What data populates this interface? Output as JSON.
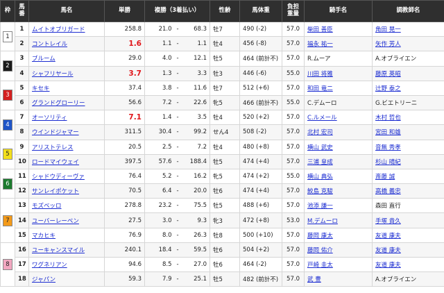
{
  "headers": {
    "waku": "枠",
    "umaban": "馬番",
    "horse": "馬名",
    "odds": "単勝",
    "place": "複勝（3着払い）",
    "sexage": "性齢",
    "weight": "馬体重",
    "load": "負担\n重量",
    "jockey": "騎手名",
    "trainer": "調教師名"
  },
  "frames": [
    {
      "label": "1",
      "color": "#ffffff",
      "text": "#222222",
      "rows": 2
    },
    {
      "label": "2",
      "color": "#1b1b1b",
      "text": "#ffffff",
      "rows": 2
    },
    {
      "label": "3",
      "color": "#d42020",
      "text": "#ffffff",
      "rows": 2
    },
    {
      "label": "4",
      "color": "#1f55c8",
      "text": "#ffffff",
      "rows": 2
    },
    {
      "label": "5",
      "color": "#f3df1c",
      "text": "#222222",
      "rows": 2
    },
    {
      "label": "6",
      "color": "#1c7a2e",
      "text": "#ffffff",
      "rows": 2
    },
    {
      "label": "7",
      "color": "#f39a1a",
      "text": "#222222",
      "rows": 3
    },
    {
      "label": "8",
      "color": "#f2a7c0",
      "text": "#222222",
      "rows": 3
    }
  ],
  "horses": [
    {
      "num": "1",
      "name": "ムイトオブリガード",
      "odds": "258.8",
      "hot": false,
      "pl_lo": "21.0",
      "pl_hi": "68.3",
      "sexage": "牡7",
      "weight": "490 (-2)",
      "load": "57.0",
      "jockey": "柴田 善臣",
      "jockey_link": true,
      "trainer": "角田 晃一",
      "trainer_link": true
    },
    {
      "num": "2",
      "name": "コントレイル",
      "odds": "1.6",
      "hot": true,
      "pl_lo": "1.1",
      "pl_hi": "1.1",
      "sexage": "牡4",
      "weight": "456 (-8)",
      "load": "57.0",
      "jockey": "福永 祐一",
      "jockey_link": true,
      "trainer": "矢作 芳人",
      "trainer_link": true
    },
    {
      "num": "3",
      "name": "ブルーム",
      "odds": "29.0",
      "hot": false,
      "pl_lo": "4.0",
      "pl_hi": "12.1",
      "sexage": "牡5",
      "weight": "464 (前計不)",
      "load": "57.0",
      "jockey": "R.ムーア",
      "jockey_link": false,
      "trainer": "A.オブライエン",
      "trainer_link": false
    },
    {
      "num": "4",
      "name": "シャフリヤール",
      "odds": "3.7",
      "hot": true,
      "pl_lo": "1.3",
      "pl_hi": "3.3",
      "sexage": "牡3",
      "weight": "446 (-6)",
      "load": "55.0",
      "jockey": "川田 将雅",
      "jockey_link": true,
      "trainer": "藤原 英昭",
      "trainer_link": true
    },
    {
      "num": "5",
      "name": "キセキ",
      "odds": "37.4",
      "hot": false,
      "pl_lo": "3.8",
      "pl_hi": "11.6",
      "sexage": "牡7",
      "weight": "512 (+6)",
      "load": "57.0",
      "jockey": "和田 竜二",
      "jockey_link": true,
      "trainer": "辻野 泰之",
      "trainer_link": true
    },
    {
      "num": "6",
      "name": "グランドグローリー",
      "odds": "56.6",
      "hot": false,
      "pl_lo": "7.2",
      "pl_hi": "22.6",
      "sexage": "牝5",
      "weight": "466 (前計不)",
      "load": "55.0",
      "jockey": "C.デムーロ",
      "jockey_link": false,
      "trainer": "G.ビエトリーニ",
      "trainer_link": false
    },
    {
      "num": "7",
      "name": "オーソリティ",
      "odds": "7.1",
      "hot": true,
      "pl_lo": "1.4",
      "pl_hi": "3.5",
      "sexage": "牡4",
      "weight": "520 (+2)",
      "load": "57.0",
      "jockey": "C.ルメール",
      "jockey_link": true,
      "trainer": "木村 哲也",
      "trainer_link": true
    },
    {
      "num": "8",
      "name": "ウインドジャマー",
      "odds": "311.5",
      "hot": false,
      "pl_lo": "30.4",
      "pl_hi": "99.2",
      "sexage": "せん4",
      "weight": "508 (-2)",
      "load": "57.0",
      "jockey": "北村 宏司",
      "jockey_link": true,
      "trainer": "宮田 和雄",
      "trainer_link": true
    },
    {
      "num": "9",
      "name": "アリストテレス",
      "odds": "20.5",
      "hot": false,
      "pl_lo": "2.5",
      "pl_hi": "7.2",
      "sexage": "牡4",
      "weight": "480 (+8)",
      "load": "57.0",
      "jockey": "横山 武史",
      "jockey_link": true,
      "trainer": "音無 秀孝",
      "trainer_link": true
    },
    {
      "num": "10",
      "name": "ロードマイウェイ",
      "odds": "397.5",
      "hot": false,
      "pl_lo": "57.6",
      "pl_hi": "188.4",
      "sexage": "牡5",
      "weight": "474 (+4)",
      "load": "57.0",
      "jockey": "三浦 皇成",
      "jockey_link": true,
      "trainer": "杉山 晴紀",
      "trainer_link": true
    },
    {
      "num": "11",
      "name": "シャドウディーヴァ",
      "odds": "76.4",
      "hot": false,
      "pl_lo": "5.2",
      "pl_hi": "16.2",
      "sexage": "牝5",
      "weight": "474 (+2)",
      "load": "55.0",
      "jockey": "横山 典弘",
      "jockey_link": true,
      "trainer": "斎藤 誠",
      "trainer_link": true
    },
    {
      "num": "12",
      "name": "サンレイポケット",
      "odds": "70.5",
      "hot": false,
      "pl_lo": "6.4",
      "pl_hi": "20.0",
      "sexage": "牡6",
      "weight": "474 (+4)",
      "load": "57.0",
      "jockey": "鮫島 克駿",
      "jockey_link": true,
      "trainer": "高橋 義忠",
      "trainer_link": true
    },
    {
      "num": "13",
      "name": "モズベッロ",
      "odds": "278.8",
      "hot": false,
      "pl_lo": "23.2",
      "pl_hi": "75.5",
      "sexage": "牡5",
      "weight": "488 (+6)",
      "load": "57.0",
      "jockey": "池添 謙一",
      "jockey_link": true,
      "trainer": "森田 直行",
      "trainer_link": false
    },
    {
      "num": "14",
      "name": "ユーバーレーベン",
      "odds": "27.5",
      "hot": false,
      "pl_lo": "3.0",
      "pl_hi": "9.3",
      "sexage": "牝3",
      "weight": "472 (+8)",
      "load": "53.0",
      "jockey": "M.デムーロ",
      "jockey_link": true,
      "trainer": "手塚 貴久",
      "trainer_link": true
    },
    {
      "num": "15",
      "name": "マカヒキ",
      "odds": "76.9",
      "hot": false,
      "pl_lo": "8.0",
      "pl_hi": "26.3",
      "sexage": "牡8",
      "weight": "500 (+10)",
      "load": "57.0",
      "jockey": "藤岡 康太",
      "jockey_link": true,
      "trainer": "友道 康夫",
      "trainer_link": true
    },
    {
      "num": "16",
      "name": "ユーキャンスマイル",
      "odds": "240.1",
      "hot": false,
      "pl_lo": "18.4",
      "pl_hi": "59.5",
      "sexage": "牡6",
      "weight": "504 (+2)",
      "load": "57.0",
      "jockey": "藤岡 佑介",
      "jockey_link": true,
      "trainer": "友道 康夫",
      "trainer_link": true
    },
    {
      "num": "17",
      "name": "ワグネリアン",
      "odds": "94.6",
      "hot": false,
      "pl_lo": "8.5",
      "pl_hi": "27.0",
      "sexage": "牡6",
      "weight": "464 (-2)",
      "load": "57.0",
      "jockey": "戸崎 圭太",
      "jockey_link": true,
      "trainer": "友道 康夫",
      "trainer_link": true
    },
    {
      "num": "18",
      "name": "ジャパン",
      "odds": "59.3",
      "hot": false,
      "pl_lo": "7.9",
      "pl_hi": "25.1",
      "sexage": "牡5",
      "weight": "482 (前計不)",
      "load": "57.0",
      "jockey": "武 豊",
      "jockey_link": true,
      "trainer": "A.オブライエン",
      "trainer_link": false
    }
  ]
}
